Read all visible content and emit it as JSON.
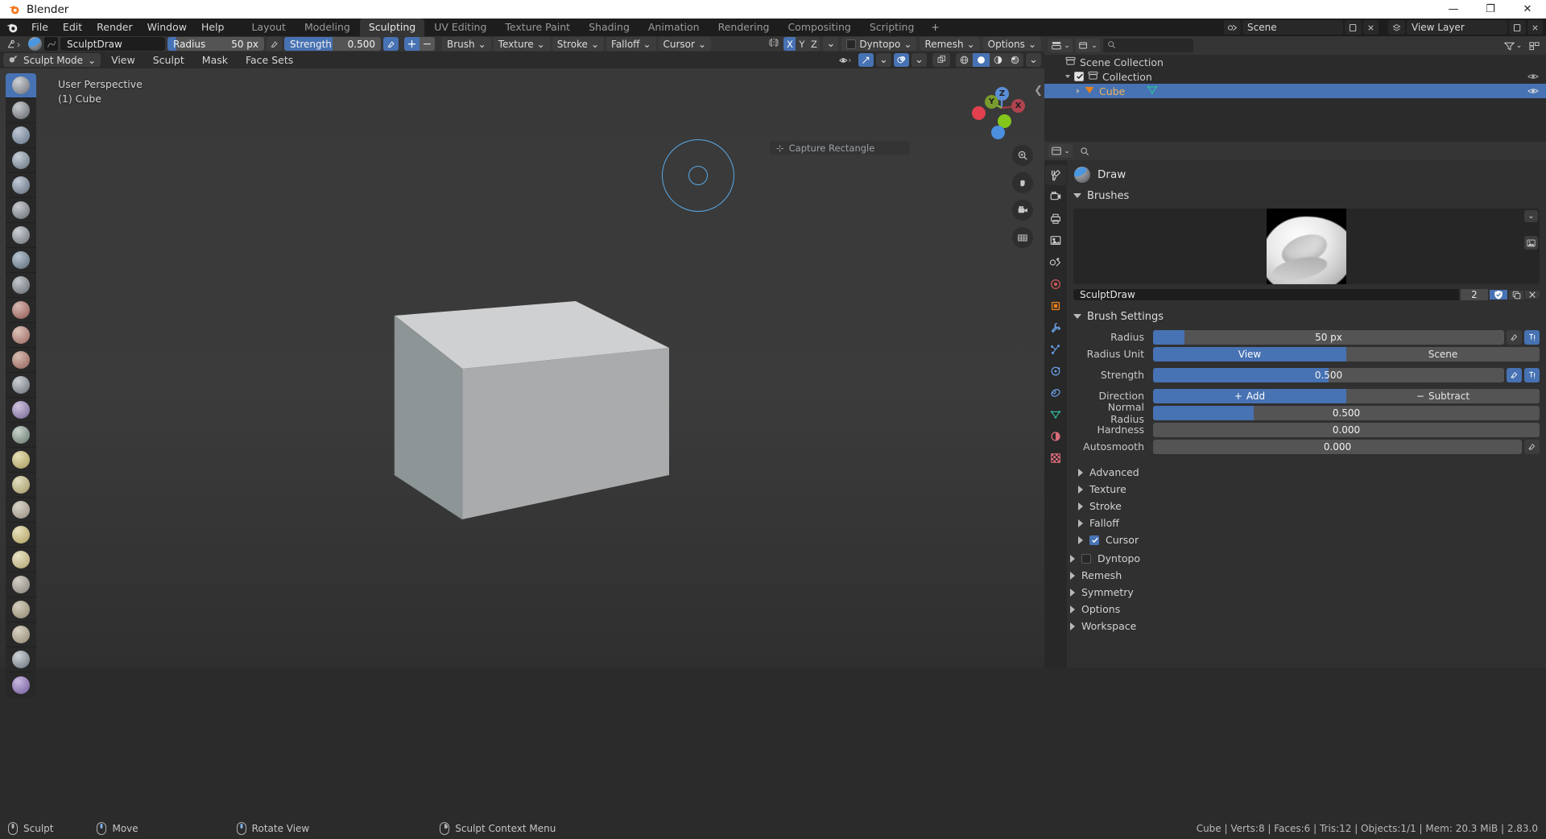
{
  "os_window": {
    "title": "Blender",
    "minimize": "—",
    "maximize": "❐",
    "close": "✕"
  },
  "topbar": {
    "menus": [
      "File",
      "Edit",
      "Render",
      "Window",
      "Help"
    ],
    "workspaces": [
      {
        "label": "Layout",
        "active": false
      },
      {
        "label": "Modeling",
        "active": false
      },
      {
        "label": "Sculpting",
        "active": true
      },
      {
        "label": "UV Editing",
        "active": false
      },
      {
        "label": "Texture Paint",
        "active": false
      },
      {
        "label": "Shading",
        "active": false
      },
      {
        "label": "Animation",
        "active": false
      },
      {
        "label": "Rendering",
        "active": false
      },
      {
        "label": "Compositing",
        "active": false
      },
      {
        "label": "Scripting",
        "active": false
      }
    ],
    "add_workspace": "+",
    "scene_name": "Scene",
    "view_layer_name": "View Layer",
    "scene_icon": "scene-icon",
    "viewlayer_icon": "viewlayer-icon",
    "new_scene_icon": "new-scene-icon",
    "remove_scene_icon": "remove-scene-icon"
  },
  "tool_settings_header": {
    "cursor_tool_icon": "active-tool-icon",
    "brush_icon": "brush-sphere-icon",
    "texture_icon": "texture-thumbnail-icon",
    "brush_name": "SculptDraw",
    "radius_label": "Radius",
    "radius_value": "50 px",
    "radius_fill_pct": 9,
    "radius_pressure_icon": "pressure-icon",
    "strength_label": "Strength",
    "strength_value": "0.500",
    "strength_fill_pct": 50,
    "strength_pressure_icon": "pressure-icon",
    "add_btn": "+",
    "subtract_btn": "−",
    "menus": [
      "Brush",
      "Texture",
      "Stroke",
      "Falloff",
      "Cursor"
    ],
    "symmetry_icon": "symmetry-icon",
    "axes": [
      {
        "label": "X",
        "on": true
      },
      {
        "label": "Y",
        "on": false
      },
      {
        "label": "Z",
        "on": false
      }
    ],
    "dyntopo_checkbox": false,
    "dyntopo_label": "Dyntopo",
    "remesh_label": "Remesh",
    "options_label": "Options"
  },
  "viewport_header": {
    "mode_label": "Sculpt Mode",
    "mode_icon": "sculpt-mode-icon",
    "menus": [
      "View",
      "Sculpt",
      "Mask",
      "Face Sets"
    ],
    "visibility_icon": "visibility-icon",
    "gizmo_icon": "gizmo-icon",
    "overlays_icon": "overlays-icon",
    "xray_icon": "xray-icon",
    "shading_modes": [
      {
        "name": "wireframe-shading-icon",
        "active": false
      },
      {
        "name": "solid-shading-icon",
        "active": true
      },
      {
        "name": "material-preview-shading-icon",
        "active": false
      },
      {
        "name": "rendered-shading-icon",
        "active": false
      }
    ]
  },
  "viewport": {
    "perspective_label": "User Perspective",
    "object_label": "(1) Cube",
    "tooltip_text": "Capture Rectangle",
    "gizmo_axes": [
      {
        "label": "Z",
        "color": "#5a8fd8"
      },
      {
        "label": "Y",
        "color": "#8dbb3a"
      },
      {
        "label": "X",
        "color": "#cc4455"
      }
    ],
    "nav_buttons": [
      "zoom-icon",
      "pan-hand-icon",
      "camera-view-icon",
      "ortho-persp-toggle-icon"
    ],
    "brush_cursor": {
      "radius_px": 45
    }
  },
  "toolbar": {
    "tools": [
      {
        "name": "draw-brush-tool",
        "active": true
      },
      {
        "name": "draw-sharp-brush-tool",
        "active": false
      },
      {
        "name": "clay-brush-tool",
        "active": false
      },
      {
        "name": "clay-strips-brush-tool",
        "active": false
      },
      {
        "name": "clay-thumb-brush-tool",
        "active": false
      },
      {
        "name": "layer-brush-tool",
        "active": false
      },
      {
        "name": "inflate-brush-tool",
        "active": false
      },
      {
        "name": "blob-brush-tool",
        "active": false
      },
      {
        "name": "crease-brush-tool",
        "active": false
      },
      {
        "name": "smooth-brush-tool",
        "active": false
      },
      {
        "name": "flatten-brush-tool",
        "active": false
      },
      {
        "name": "fill-brush-tool",
        "active": false
      },
      {
        "name": "scrape-brush-tool",
        "active": false
      },
      {
        "name": "multiplane-scrape-brush-tool",
        "active": false
      },
      {
        "name": "pinch-brush-tool",
        "active": false
      },
      {
        "name": "grab-brush-tool",
        "active": false
      },
      {
        "name": "elastic-deform-brush-tool",
        "active": false
      },
      {
        "name": "snake-hook-brush-tool",
        "active": false
      },
      {
        "name": "thumb-brush-tool",
        "active": false
      },
      {
        "name": "pose-brush-tool",
        "active": false
      },
      {
        "name": "nudge-brush-tool",
        "active": false
      },
      {
        "name": "rotate-brush-tool",
        "active": false
      },
      {
        "name": "slide-relax-brush-tool",
        "active": false
      },
      {
        "name": "simplify-brush-tool",
        "active": false
      },
      {
        "name": "mask-brush-tool",
        "active": false
      }
    ]
  },
  "outliner": {
    "display_mode_icon": "outliner-display-mode-icon",
    "filter_icon": "filter-icon",
    "new_collection_icon": "new-collection-icon",
    "search_placeholder": "",
    "search_icon": "search-icon",
    "rows": [
      {
        "label": "Scene Collection",
        "icon": "collection-icon",
        "indent": 0,
        "selected": false,
        "has_tri": false,
        "has_check": false
      },
      {
        "label": "Collection",
        "icon": "collection-icon",
        "indent": 1,
        "selected": false,
        "has_tri": true,
        "tri_open": true,
        "has_check": true,
        "checked": true
      },
      {
        "label": "Cube",
        "icon": "mesh-object-icon",
        "indent": 2,
        "selected": true,
        "has_tri": true,
        "tri_open": false,
        "has_check": false,
        "data_icon": "mesh-data-icon"
      }
    ]
  },
  "properties": {
    "header_icons": [
      "properties-editor-icon",
      "properties-search-icon"
    ],
    "tabs": [
      {
        "name": "tool-properties-tab",
        "active": true
      },
      {
        "name": "render-properties-tab",
        "active": false
      },
      {
        "name": "output-properties-tab",
        "active": false
      },
      {
        "name": "view-layer-properties-tab",
        "active": false
      },
      {
        "name": "scene-properties-tab",
        "active": false
      },
      {
        "name": "world-properties-tab",
        "active": false
      },
      {
        "name": "object-properties-tab",
        "active": false
      },
      {
        "name": "modifier-properties-tab",
        "active": false
      },
      {
        "name": "particle-properties-tab",
        "active": false
      },
      {
        "name": "physics-properties-tab",
        "active": false
      },
      {
        "name": "constraint-properties-tab",
        "active": false
      },
      {
        "name": "object-data-properties-tab",
        "active": false
      },
      {
        "name": "material-properties-tab",
        "active": false
      },
      {
        "name": "texture-properties-tab",
        "active": false
      }
    ],
    "tool_title": "Draw",
    "tool_icon": "brush-sphere-icon",
    "brushes_panel": "Brushes",
    "brush_name": "SculptDraw",
    "brush_users": "2",
    "brush_fake_user_icon": "shield-icon",
    "brush_copy_icon": "duplicate-icon",
    "brush_unlink_icon": "x-icon",
    "brush_settings_panel": "Brush Settings",
    "settings": [
      {
        "label": "Radius",
        "value": "50 px",
        "fill_pct": 9,
        "type": "slider",
        "has_pressure": true,
        "has_unified": true
      },
      {
        "label": "Radius Unit",
        "type": "segmented",
        "options": [
          {
            "label": "View",
            "on": true
          },
          {
            "label": "Scene",
            "on": false
          }
        ]
      },
      {
        "label": "Strength",
        "value": "0.500",
        "fill_pct": 50,
        "type": "slider",
        "has_pressure": true,
        "has_unified": true
      },
      {
        "label": "Direction",
        "type": "segmented",
        "options": [
          {
            "label": "Add",
            "on": true,
            "glyph": "+"
          },
          {
            "label": "Subtract",
            "on": false,
            "glyph": "−"
          }
        ]
      },
      {
        "label": "Normal Radius",
        "value": "0.500",
        "fill_pct": 26,
        "type": "slider",
        "has_pressure": false,
        "has_unified": false
      },
      {
        "label": "Hardness",
        "value": "0.000",
        "fill_pct": 0,
        "type": "slider",
        "has_pressure": false,
        "has_unified": false
      },
      {
        "label": "Autosmooth",
        "value": "0.000",
        "fill_pct": 0,
        "type": "slider",
        "has_pressure": true,
        "has_unified": false
      }
    ],
    "subsections": [
      {
        "label": "Advanced",
        "indent": 1,
        "checkbox": null
      },
      {
        "label": "Texture",
        "indent": 1,
        "checkbox": null
      },
      {
        "label": "Stroke",
        "indent": 1,
        "checkbox": null
      },
      {
        "label": "Falloff",
        "indent": 1,
        "checkbox": null
      },
      {
        "label": "Cursor",
        "indent": 1,
        "checkbox": true
      },
      {
        "label": "Dyntopo",
        "indent": 0,
        "checkbox": false
      },
      {
        "label": "Remesh",
        "indent": 0,
        "checkbox": null
      },
      {
        "label": "Symmetry",
        "indent": 0,
        "checkbox": null
      },
      {
        "label": "Options",
        "indent": 0,
        "checkbox": null
      },
      {
        "label": "Workspace",
        "indent": 0,
        "checkbox": null
      }
    ]
  },
  "statusbar": {
    "hints": [
      {
        "icon": "mouse-left-icon",
        "label": "Sculpt"
      },
      {
        "icon": "mouse-middle-icon",
        "label": "Move"
      },
      {
        "icon": "mouse-middle-icon",
        "label": "Rotate View"
      },
      {
        "icon": "mouse-right-icon",
        "label": "Sculpt Context Menu"
      }
    ],
    "stats": "Cube | Verts:8 | Faces:6 | Tris:12 | Objects:1/1 | Mem: 20.3 MiB | 2.83.0"
  },
  "colors": {
    "accent": "#4772b3",
    "panel": "#303030",
    "header": "#353535",
    "editor": "#2b2b2b",
    "topbar": "#1d1d1d",
    "brush_cursor": "#5aa9e6"
  }
}
